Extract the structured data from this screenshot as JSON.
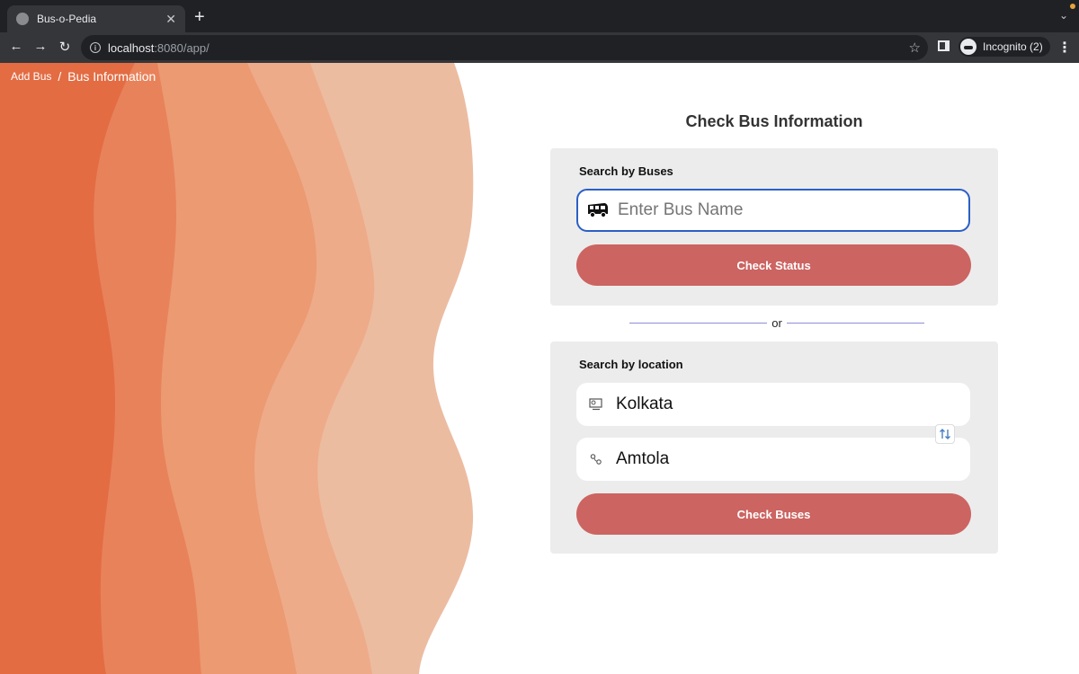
{
  "browser": {
    "tab_title": "Bus-o-Pedia",
    "tab_close": "✕",
    "new_tab": "+",
    "tab_menu": "⌄",
    "url_host": "localhost",
    "url_path": ":8080/app/",
    "profile_label": "Incognito (2)",
    "back": "←",
    "forward": "→",
    "reload": "↻",
    "star": "☆",
    "menu": "⋮"
  },
  "breadcrumb": {
    "link": "Add Bus",
    "separator": "/",
    "current": "Bus Information"
  },
  "page": {
    "title": "Check Bus Information"
  },
  "search_by_bus": {
    "label": "Search by Buses",
    "placeholder": "Enter Bus Name",
    "button": "Check Status"
  },
  "divider": {
    "text": "or"
  },
  "search_by_location": {
    "label": "Search by location",
    "from_value": "Kolkata",
    "to_value": "Amtola",
    "button": "Check Buses"
  },
  "colors": {
    "button": "#cc6461",
    "wave_1": "#e36c43",
    "wave_2": "#e8825a",
    "wave_3": "#ec9a72",
    "wave_4": "#eeab89",
    "wave_5": "#ecbca1"
  }
}
